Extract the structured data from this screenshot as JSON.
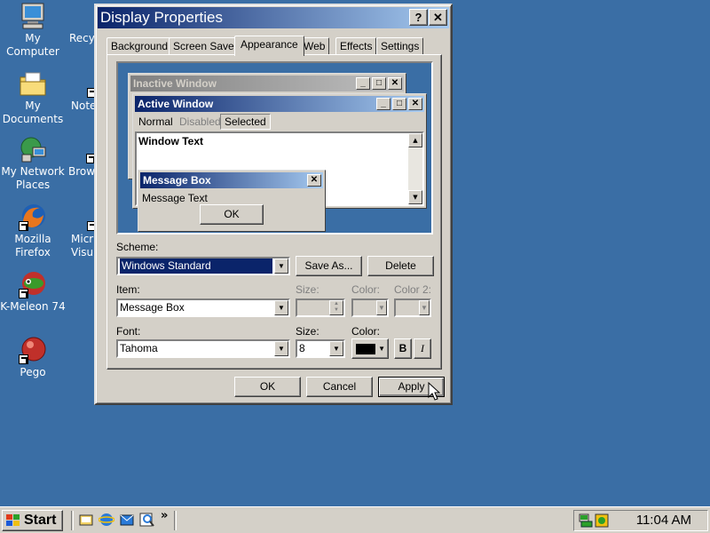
{
  "desktop": {
    "icons": [
      {
        "label": "My Computer"
      },
      {
        "label": "My Documents"
      },
      {
        "label": "My Network Places"
      },
      {
        "label": "Mozilla Firefox"
      },
      {
        "label": "K-Meleon 74"
      },
      {
        "label": "Pego"
      },
      {
        "label": "Recy"
      },
      {
        "label": "Note"
      },
      {
        "label": "Brow"
      },
      {
        "label": "Micr Visu"
      }
    ]
  },
  "dialog": {
    "title": "Display Properties",
    "help_glyph": "?",
    "close_glyph": "✕",
    "tabs": [
      "Background",
      "Screen Saver",
      "Appearance",
      "Web",
      "Effects",
      "Settings"
    ],
    "active_tab": "Appearance",
    "preview": {
      "inactive_title": "Inactive Window",
      "active_title": "Active Window",
      "menu": {
        "normal": "Normal",
        "disabled": "Disabled",
        "selected": "Selected"
      },
      "window_text": "Window Text",
      "msgbox_title": "Message Box",
      "msgbox_text": "Message Text",
      "ok": "OK"
    },
    "scheme": {
      "label": "Scheme:",
      "value": "Windows Standard",
      "save_as": "Save As...",
      "delete": "Delete"
    },
    "item": {
      "label": "Item:",
      "value": "Message Box",
      "size_label": "Size:",
      "color_label": "Color:",
      "color2_label": "Color 2:"
    },
    "font": {
      "label": "Font:",
      "value": "Tahoma",
      "size_label": "Size:",
      "size_value": "8",
      "color_label": "Color:",
      "bold": "B",
      "italic": "I"
    },
    "buttons": {
      "ok": "OK",
      "cancel": "Cancel",
      "apply": "Apply"
    }
  },
  "taskbar": {
    "start": "Start",
    "chevron": "»",
    "clock": "11:04 AM"
  },
  "colors": {
    "desktop": "#3a6ea5",
    "titlebar_active": "#0a246a",
    "titlebar_inactive": "#808080",
    "face": "#d4d0c8"
  }
}
